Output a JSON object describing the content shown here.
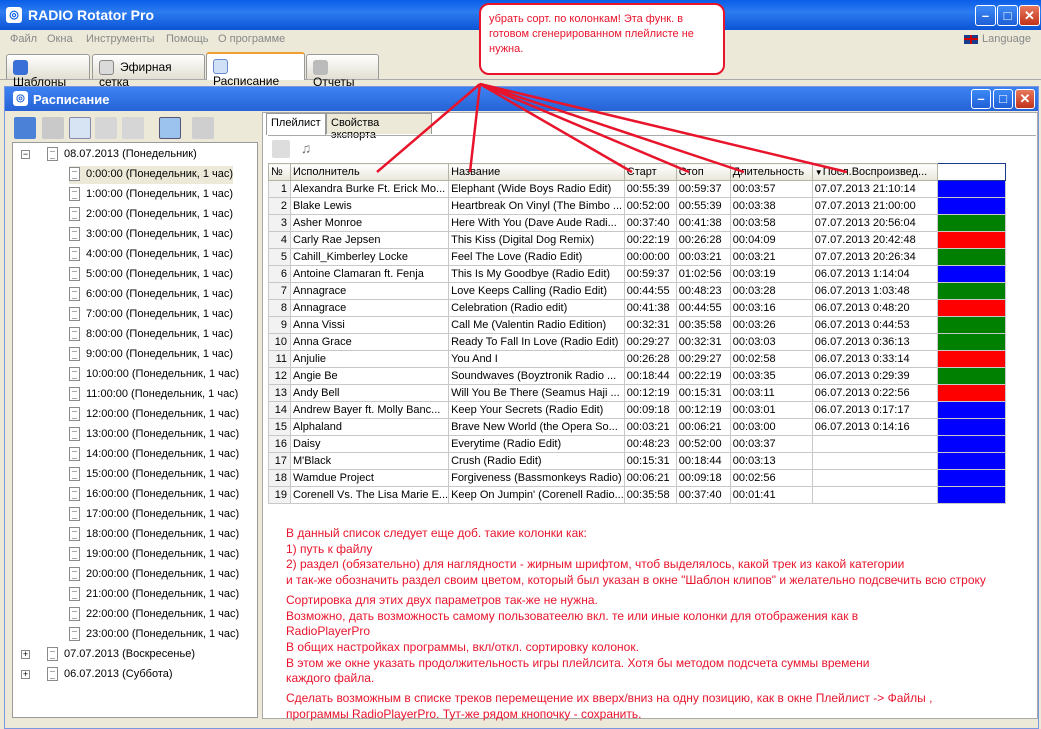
{
  "app": {
    "title": "RADIO Rotator Pro"
  },
  "menu": [
    "Файл",
    "Окна",
    "Инструменты",
    "Помощь",
    "О программе"
  ],
  "language": "Language",
  "tabs": [
    "Шаблоны",
    "Эфирная сетка",
    "Расписание",
    "Отчеты"
  ],
  "inner_title": "Расписание",
  "tree": {
    "root": "08.07.2013 (Понедельник)",
    "hours": [
      "0:00:00 (Понедельник, 1 час)",
      "1:00:00 (Понедельник, 1 час)",
      "2:00:00 (Понедельник, 1 час)",
      "3:00:00 (Понедельник, 1 час)",
      "4:00:00 (Понедельник, 1 час)",
      "5:00:00 (Понедельник, 1 час)",
      "6:00:00 (Понедельник, 1 час)",
      "7:00:00 (Понедельник, 1 час)",
      "8:00:00 (Понедельник, 1 час)",
      "9:00:00 (Понедельник, 1 час)",
      "10:00:00 (Понедельник, 1 час)",
      "11:00:00 (Понедельник, 1 час)",
      "12:00:00 (Понедельник, 1 час)",
      "13:00:00 (Понедельник, 1 час)",
      "14:00:00 (Понедельник, 1 час)",
      "15:00:00 (Понедельник, 1 час)",
      "16:00:00 (Понедельник, 1 час)",
      "17:00:00 (Понедельник, 1 час)",
      "18:00:00 (Понедельник, 1 час)",
      "19:00:00 (Понедельник, 1 час)",
      "20:00:00 (Понедельник, 1 час)",
      "21:00:00 (Понедельник, 1 час)",
      "22:00:00 (Понедельник, 1 час)",
      "23:00:00 (Понедельник, 1 час)"
    ],
    "other_days": [
      "07.07.2013 (Воскресенье)",
      "06.07.2013 (Суббота)"
    ]
  },
  "panel_tabs": [
    "Плейлист",
    "Свойства экспорта"
  ],
  "columns": [
    "№",
    "Исполнитель",
    "Название",
    "Старт",
    "Стоп",
    "Длительность",
    "Посл.Воспроизвед..."
  ],
  "rows": [
    {
      "n": "1",
      "artist": "Alexandra Burke Ft. Erick Mo...",
      "title": "Elephant (Wide Boys Radio Edit)",
      "start": "00:55:39",
      "stop": "00:59:37",
      "dur": "00:03:57",
      "last": "07.07.2013 21:10:14",
      "color": "#0000ff"
    },
    {
      "n": "2",
      "artist": "Blake Lewis",
      "title": "Heartbreak On Vinyl (The Bimbo ...",
      "start": "00:52:00",
      "stop": "00:55:39",
      "dur": "00:03:38",
      "last": "07.07.2013 21:00:00",
      "color": "#0000ff"
    },
    {
      "n": "3",
      "artist": "Asher Monroe",
      "title": "Here With You (Dave Aude Radi...",
      "start": "00:37:40",
      "stop": "00:41:38",
      "dur": "00:03:58",
      "last": "07.07.2013 20:56:04",
      "color": "#008000"
    },
    {
      "n": "4",
      "artist": "Carly Rae Jepsen",
      "title": "This Kiss (Digital Dog Remix)",
      "start": "00:22:19",
      "stop": "00:26:28",
      "dur": "00:04:09",
      "last": "07.07.2013 20:42:48",
      "color": "#ff0000"
    },
    {
      "n": "5",
      "artist": "Cahill_Kimberley Locke",
      "title": "Feel The Love (Radio Edit)",
      "start": "00:00:00",
      "stop": "00:03:21",
      "dur": "00:03:21",
      "last": "07.07.2013 20:26:34",
      "color": "#008000"
    },
    {
      "n": "6",
      "artist": "Antoine Clamaran ft. Fenja",
      "title": "This Is My Goodbye (Radio Edit)",
      "start": "00:59:37",
      "stop": "01:02:56",
      "dur": "00:03:19",
      "last": "06.07.2013 1:14:04",
      "color": "#0000ff"
    },
    {
      "n": "7",
      "artist": "Annagrace",
      "title": "Love Keeps Calling (Radio Edit)",
      "start": "00:44:55",
      "stop": "00:48:23",
      "dur": "00:03:28",
      "last": "06.07.2013 1:03:48",
      "color": "#008000"
    },
    {
      "n": "8",
      "artist": "Annagrace",
      "title": "Celebration (Radio edit)",
      "start": "00:41:38",
      "stop": "00:44:55",
      "dur": "00:03:16",
      "last": "06.07.2013 0:48:20",
      "color": "#ff0000"
    },
    {
      "n": "9",
      "artist": "Anna Vissi",
      "title": "Call Me (Valentin Radio Edition)",
      "start": "00:32:31",
      "stop": "00:35:58",
      "dur": "00:03:26",
      "last": "06.07.2013 0:44:53",
      "color": "#008000"
    },
    {
      "n": "10",
      "artist": "Anna Grace",
      "title": "Ready To Fall In Love (Radio Edit)",
      "start": "00:29:27",
      "stop": "00:32:31",
      "dur": "00:03:03",
      "last": "06.07.2013 0:36:13",
      "color": "#008000"
    },
    {
      "n": "11",
      "artist": "Anjulie",
      "title": "You And I",
      "start": "00:26:28",
      "stop": "00:29:27",
      "dur": "00:02:58",
      "last": "06.07.2013 0:33:14",
      "color": "#ff0000"
    },
    {
      "n": "12",
      "artist": "Angie Be",
      "title": "Soundwaves (Boyztronik Radio ...",
      "start": "00:18:44",
      "stop": "00:22:19",
      "dur": "00:03:35",
      "last": "06.07.2013 0:29:39",
      "color": "#008000"
    },
    {
      "n": "13",
      "artist": "Andy Bell",
      "title": "Will You Be There (Seamus Haji ...",
      "start": "00:12:19",
      "stop": "00:15:31",
      "dur": "00:03:11",
      "last": "06.07.2013 0:22:56",
      "color": "#ff0000"
    },
    {
      "n": "14",
      "artist": "Andrew Bayer ft. Molly Banc...",
      "title": "Keep Your Secrets (Radio Edit)",
      "start": "00:09:18",
      "stop": "00:12:19",
      "dur": "00:03:01",
      "last": "06.07.2013 0:17:17",
      "color": "#0000ff"
    },
    {
      "n": "15",
      "artist": "Alphaland",
      "title": "Brave New World (the Opera So...",
      "start": "00:03:21",
      "stop": "00:06:21",
      "dur": "00:03:00",
      "last": "06.07.2013 0:14:16",
      "color": "#0000ff"
    },
    {
      "n": "16",
      "artist": "Daisy",
      "title": "Everytime (Radio Edit)",
      "start": "00:48:23",
      "stop": "00:52:00",
      "dur": "00:03:37",
      "last": "",
      "color": "#0000ff"
    },
    {
      "n": "17",
      "artist": "M'Black",
      "title": "Crush (Radio Edit)",
      "start": "00:15:31",
      "stop": "00:18:44",
      "dur": "00:03:13",
      "last": "",
      "color": "#0000ff"
    },
    {
      "n": "18",
      "artist": "Wamdue Project",
      "title": "Forgiveness (Bassmonkeys Radio)",
      "start": "00:06:21",
      "stop": "00:09:18",
      "dur": "00:02:56",
      "last": "",
      "color": "#0000ff"
    },
    {
      "n": "19",
      "artist": "Corenell Vs. The Lisa Marie E...",
      "title": "Keep On Jumpin' (Corenell Radio...",
      "start": "00:35:58",
      "stop": "00:37:40",
      "dur": "00:01:41",
      "last": "",
      "color": "#0000ff"
    }
  ],
  "callout": "убрать сорт. по колонкам! Эта функ. в готовом сгенерированном плейлисте не нужна.",
  "notes": [
    "В данный список следует еще доб. такие колонки как:",
    "1) путь к файлу",
    "2) раздел (обязательно) для наглядности - жирным шрифтом, чтоб выделялось, какой трек из какой категории",
    " и так-же обозначить раздел своим цветом, который был указан в окне \"Шаблон клипов\" и желательно подсвечить всю строку",
    "Сортировка для этих двух параметров так-же не нужна.",
    "Возможно, дать возможность самому пользоватеелю вкл. те или иные колонки для отображения как в",
    "RadioPlayerPro",
    "В общих настройках программы, вкл/откл. сортировку колонок.",
    "В этом же окне указать продолжительность игры плейлсита. Хотя бы методом подсчета суммы времени",
    "каждого файла.",
    "Сделать возможным в списке треков перемещение их вверх/вниз на одну позицию, как в окне Плейлист -> Файлы ,",
    "программы RadioPlayerPro.   Тут-же рядом кнопочку - сохранить."
  ]
}
